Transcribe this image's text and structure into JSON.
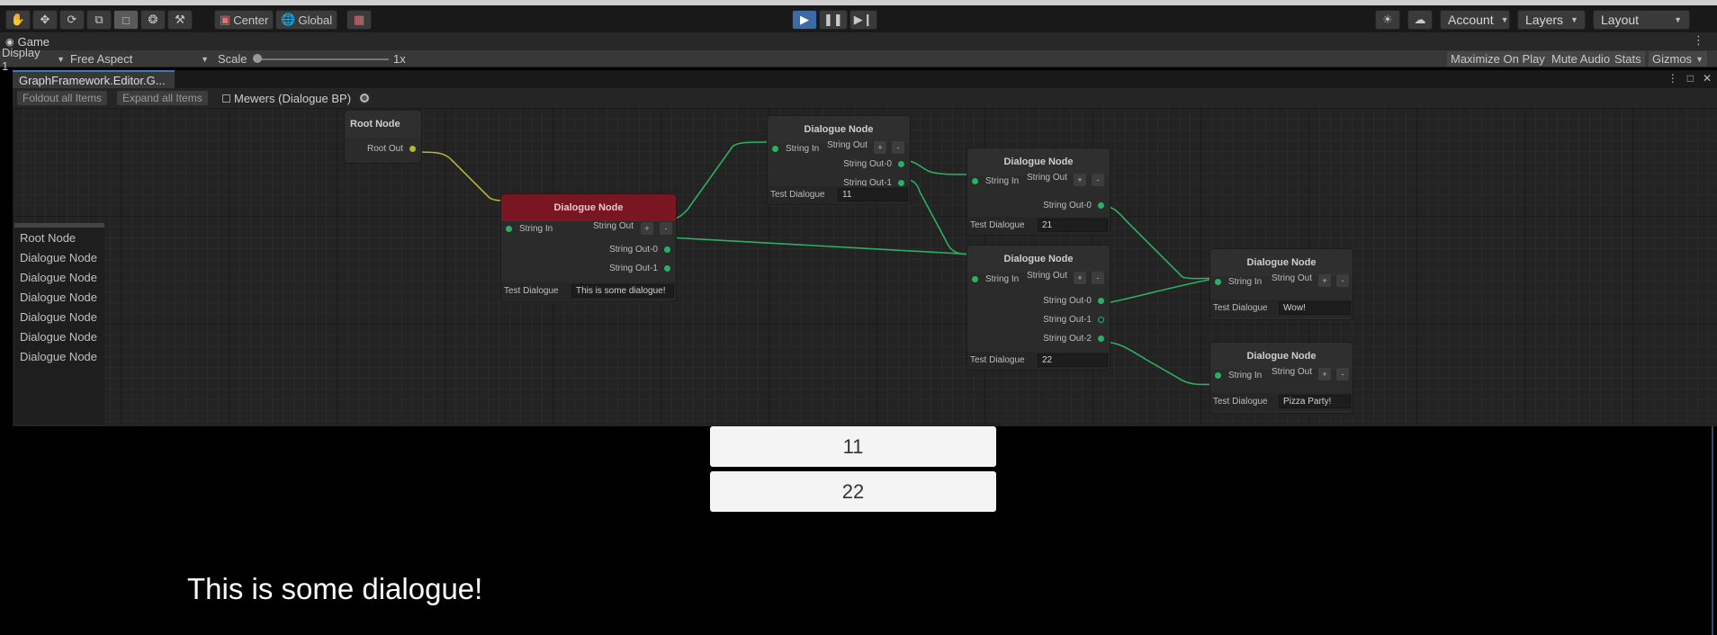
{
  "toolbar": {
    "tools": [
      "hand-tool",
      "move-tool",
      "rotate-tool",
      "scale-tool",
      "rect-tool",
      "transform-tool",
      "custom-tool"
    ],
    "pivot_label": "Center",
    "space_label": "Global",
    "account_label": "Account",
    "layers_label": "Layers",
    "layout_label": "Layout"
  },
  "game_tab": {
    "label": "Game"
  },
  "game_controls": {
    "display": "Display 1",
    "aspect": "Free Aspect",
    "scale_label": "Scale",
    "scale_value": "1x",
    "maximize": "Maximize On Play",
    "mute": "Mute Audio",
    "stats": "Stats",
    "gizmos": "Gizmos"
  },
  "graph_window": {
    "tab_label": "GraphFramework.Editor.G...",
    "foldout_label": "Foldout all Items",
    "expand_label": "Expand all Items",
    "object_label": "Mewers (Dialogue BP)",
    "list_items": [
      "Root Node",
      "Dialogue Node",
      "Dialogue Node",
      "Dialogue Node",
      "Dialogue Node",
      "Dialogue Node",
      "Dialogue Node"
    ]
  },
  "nodes": {
    "root": {
      "title": "Root Node",
      "out": "Root Out"
    },
    "n1": {
      "title": "Dialogue Node",
      "in": "String In",
      "out_header": "String Out",
      "outs": [
        "String Out-0",
        "String Out-1"
      ],
      "field_label": "Test Dialogue",
      "field_value": "This is some dialogue!"
    },
    "n2": {
      "title": "Dialogue Node",
      "in": "String In",
      "out_header": "String Out",
      "outs": [
        "String Out-0",
        "String Out-1"
      ],
      "field_label": "Test Dialogue",
      "field_value": "11"
    },
    "n3": {
      "title": "Dialogue Node",
      "in": "String In",
      "out_header": "String Out",
      "outs": [
        "String Out-0"
      ],
      "field_label": "Test Dialogue",
      "field_value": "21"
    },
    "n4": {
      "title": "Dialogue Node",
      "in": "String In",
      "out_header": "String Out",
      "outs": [
        "String Out-0",
        "String Out-1",
        "String Out-2"
      ],
      "field_label": "Test Dialogue",
      "field_value": "22"
    },
    "n5": {
      "title": "Dialogue Node",
      "in": "String In",
      "out_header": "String Out",
      "field_label": "Test Dialogue",
      "field_value": "Wow!"
    },
    "n6": {
      "title": "Dialogue Node",
      "in": "String In",
      "out_header": "String Out",
      "field_label": "Test Dialogue",
      "field_value": "Pizza Party!"
    },
    "plus": "+",
    "minus": "-"
  },
  "game_view": {
    "choices": [
      "11",
      "22"
    ],
    "dialogue": "This is some dialogue!"
  },
  "colors": {
    "play_button": "#3b6aa5",
    "selected_node_header": "#7a1622",
    "edge_green": "#2bb063",
    "edge_yellow": "#b7b72b"
  }
}
